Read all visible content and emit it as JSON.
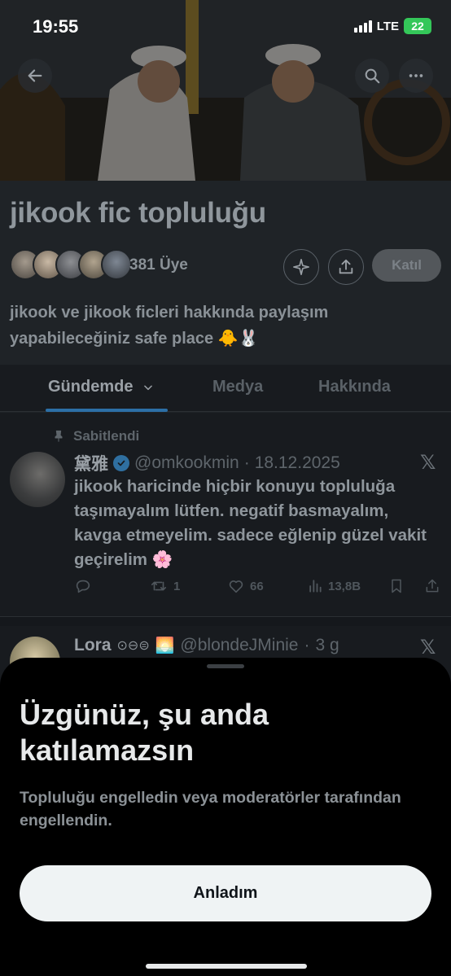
{
  "status_bar": {
    "time": "19:55",
    "network": "LTE",
    "battery": "22"
  },
  "community": {
    "title": "jikook fic topluluğu",
    "member_count": "381 Üye",
    "join_label": "Katıl",
    "description": "jikook ve jikook ficleri hakkında paylaşım yapabileceğiniz safe place 🐥🐰"
  },
  "tabs": [
    {
      "label": "Gündemde"
    },
    {
      "label": "Medya"
    },
    {
      "label": "Hakkında"
    }
  ],
  "pinned_post": {
    "pinned_label": "Sabitlendi",
    "author_name": "黛雅",
    "handle": "@omkookmin",
    "separator": "·",
    "date": "18.12.2025",
    "text": "jikook haricinde hiçbir konuyu topluluğa taşımayalım lütfen. negatif basmayalım, kavga etmeyelim. sadece eğlenip güzel vakit geçirelim 🌸",
    "reposts": "1",
    "likes": "66",
    "views": "13,8B"
  },
  "second_post": {
    "author_name": "Lora",
    "author_symbols": "⊙⊖⊜",
    "author_emoji": "🌅",
    "handle": "@blondeJMinie",
    "separator": "·",
    "time": "3 g"
  },
  "sheet": {
    "title": "Üzgünüz, şu anda katılamazsın",
    "body": "Topluluğu engelledin veya moderatörler tarafından engellendin.",
    "button_label": "Anladım"
  },
  "colors": {
    "sheet_bg": "#000000",
    "button_bg": "#eff3f4",
    "accent": "#1d9bf0"
  }
}
